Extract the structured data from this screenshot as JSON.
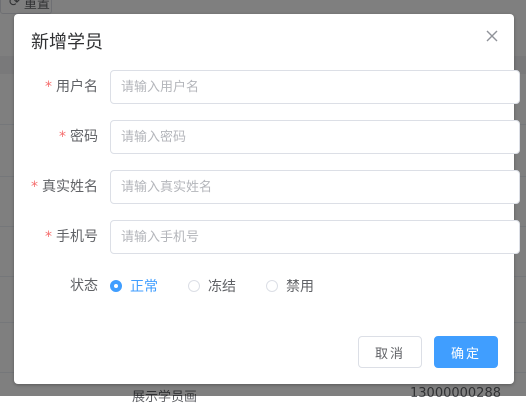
{
  "background": {
    "reset_label": "重置",
    "row_text": "展示学员画",
    "row_phone": "13000000288"
  },
  "dialog": {
    "title": "新增学员",
    "fields": [
      {
        "label": "用户名",
        "required": true,
        "placeholder": "请输入用户名"
      },
      {
        "label": "密码",
        "required": true,
        "placeholder": "请输入密码"
      },
      {
        "label": "真实姓名",
        "required": true,
        "placeholder": "请输入真实姓名"
      },
      {
        "label": "手机号",
        "required": true,
        "placeholder": "请输入手机号"
      }
    ],
    "required_mark": "*",
    "status": {
      "label": "状态",
      "options": [
        "正常",
        "冻结",
        "禁用"
      ],
      "selected": "正常"
    },
    "cancel_label": "取消",
    "confirm_label": "确定"
  },
  "colors": {
    "primary": "#409eff",
    "required": "#f56c6c",
    "overlay": "rgba(0,0,0,0.5)"
  },
  "icons": {
    "close": "close-icon",
    "reset": "refresh-icon"
  }
}
